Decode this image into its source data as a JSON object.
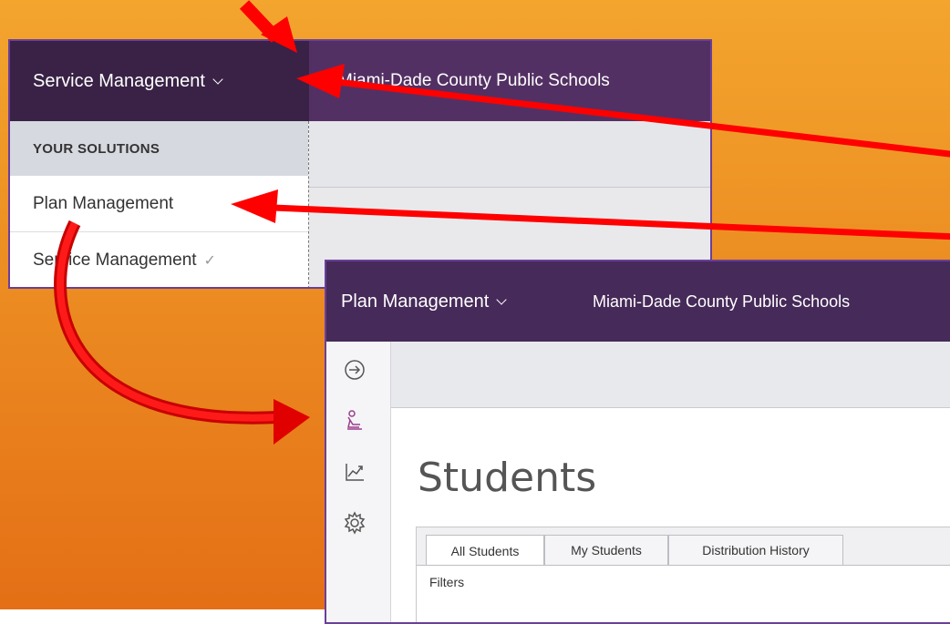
{
  "colors": {
    "background_top": "#f3a52e",
    "background_bottom": "#e46f16",
    "appbar_purple": "#533063",
    "solution_button_dark": "#392246",
    "frame_border": "#6a3f99",
    "annotation_red": "#ff0000"
  },
  "service_view": {
    "solution_button_label": "Service Management",
    "district_name": "Miami-Dade County Public Schools",
    "dropdown": {
      "header": "YOUR SOLUTIONS",
      "items": [
        {
          "label": "Plan Management",
          "selected": false
        },
        {
          "label": "Service Management",
          "selected": true
        }
      ],
      "check_glyph": "✓"
    }
  },
  "plan_view": {
    "solution_button_label": "Plan Management",
    "district_name": "Miami-Dade County Public Schools",
    "sidebar_icons": [
      "arrow-right-circle-icon",
      "person-reading-icon",
      "trending-chart-icon",
      "gear-icon"
    ],
    "page_title": "Students",
    "tabs": [
      {
        "label": "All Students",
        "active": true
      },
      {
        "label": "My Students",
        "active": false
      },
      {
        "label": "Distribution History",
        "active": false
      }
    ],
    "filters_label": "Filters"
  }
}
